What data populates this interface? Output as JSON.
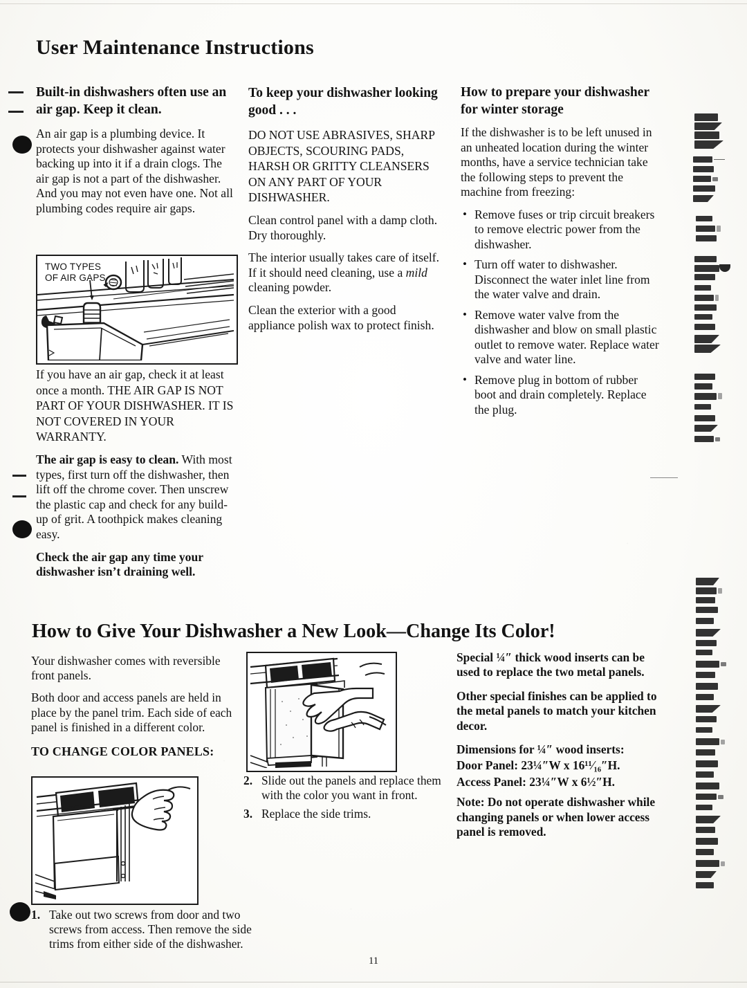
{
  "document": {
    "title": "User Maintenance Instructions",
    "page_number": "11"
  },
  "upper": {
    "col1": {
      "heading": "Built-in dishwashers often use an air gap. Keep it clean.",
      "p1": "An air gap is a plumbing device. It protects your dishwasher against water backing up into it if a drain clogs. The air gap is not a part of the dishwasher. And you may not even have one. Not all plumbing codes require air gaps.",
      "figure": {
        "label_line1": "TWO TYPES",
        "label_line2": "OF AIR GAPS",
        "alt": "Illustration of a kitchen sink countertop showing two types of air gap fittings"
      },
      "p2": "If you have an air gap, check it at least once a month. THE AIR GAP IS NOT PART OF YOUR DISHWASHER. IT IS NOT COVERED IN YOUR WARRANTY.",
      "p3_bold": "The air gap is easy to clean.",
      "p3_rest": " With most types, first turn off the dishwasher, then lift off the chrome cover. Then unscrew the plastic cap and check for any build-up of grit. A toothpick makes cleaning easy.",
      "p4": "Check the air gap any time your dishwasher isn’t draining well."
    },
    "col2": {
      "heading": "To keep your dishwasher looking good . . .",
      "p1": "DO NOT USE ABRASIVES, SHARP OBJECTS, SCOURING PADS, HARSH OR GRITTY CLEANSERS ON ANY PART OF YOUR DISHWASHER.",
      "p2": "Clean control panel with a damp cloth. Dry thoroughly.",
      "p3_a": "The interior usually takes care of itself. If it should need cleaning, use a ",
      "p3_italic": "mild",
      "p3_b": " cleaning powder.",
      "p4": "Clean the exterior with a good appliance polish wax to protect finish."
    },
    "col3": {
      "heading": "How to prepare your dishwasher for winter storage",
      "p1": "If the dishwasher is to be left unused in an unheated location during the winter months, have a service technician take the following steps to prevent the machine from freezing:",
      "bullets": [
        "Remove fuses or trip circuit breakers to remove electric power from the dishwasher.",
        "Turn off water to dishwasher. Disconnect the water inlet line from the water valve and drain.",
        "Remove water valve from the dishwasher and blow on small plastic outlet to remove water. Replace water valve and water line.",
        "Remove plug in bottom of rubber boot and drain completely. Replace the plug."
      ]
    }
  },
  "lower": {
    "heading": "How to Give Your Dishwasher a New Look—Change Its Color!",
    "col1": {
      "p1": "Your dishwasher comes with reversible front panels.",
      "p2": "Both door and access panels are held in place by the panel trim. Each side of each panel is finished in a different color.",
      "caption": "TO CHANGE COLOR PANELS:",
      "figure_alt": "Illustration of a hand using a screwdriver to remove screws from the dishwasher side trim",
      "step1_num": "1.",
      "step1_text": "Take out two screws from door and two screws from access. Then remove the side trims from either side of the dishwasher."
    },
    "col2": {
      "figure_alt": "Illustration of two hands sliding the front panel out of the dishwasher door",
      "step2_num": "2.",
      "step2_text": "Slide out the panels and replace them with the color you want in front.",
      "step3_num": "3.",
      "step3_text": "Replace the side trims."
    },
    "col3": {
      "p1": "Special ¼″ thick wood inserts can be used to replace the two metal panels.",
      "p2": "Other special finishes can be applied to the metal panels to match your kitchen decor.",
      "dim_heading": "Dimensions for ¼″ wood inserts:",
      "dim_door": "Door Panel: 23¼″W x 16¹¹⁄₁₆″H.",
      "dim_access": "Access Panel: 23¼″W x  6½″H.",
      "note": "Note: Do not operate dishwasher while changing panels or when lower access panel is removed."
    }
  },
  "artifacts": {
    "right_margin_bleed": "illegible dark scanned text bleed-through along the right edge"
  }
}
